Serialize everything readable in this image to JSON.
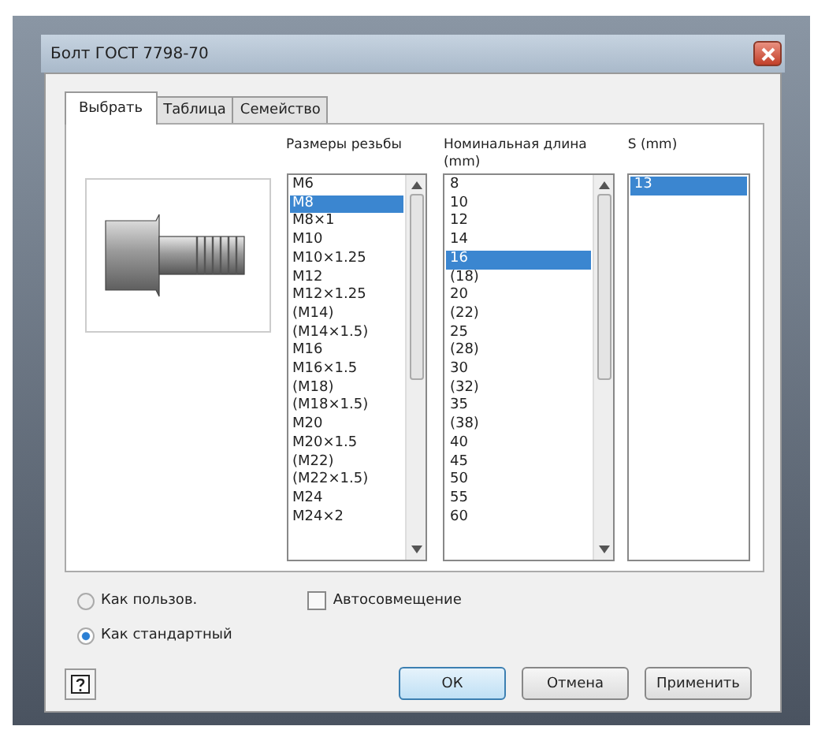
{
  "window": {
    "title": "Болт ГОСТ 7798-70"
  },
  "tabs": [
    {
      "label": "Выбрать",
      "selected": true
    },
    {
      "label": "Таблица",
      "selected": false
    },
    {
      "label": "Семейство",
      "selected": false
    }
  ],
  "lists": [
    {
      "header": "Размеры резьбы",
      "items": [
        {
          "label": "M6",
          "selected": false
        },
        {
          "label": "M8",
          "selected": true
        },
        {
          "label": "M8×1",
          "selected": false
        },
        {
          "label": "M10",
          "selected": false
        },
        {
          "label": "M10×1.25",
          "selected": false
        },
        {
          "label": "M12",
          "selected": false
        },
        {
          "label": "M12×1.25",
          "selected": false
        },
        {
          "label": "(M14)",
          "selected": false
        },
        {
          "label": "(M14×1.5)",
          "selected": false
        },
        {
          "label": "M16",
          "selected": false
        },
        {
          "label": "M16×1.5",
          "selected": false
        },
        {
          "label": "(M18)",
          "selected": false
        },
        {
          "label": "(M18×1.5)",
          "selected": false
        },
        {
          "label": "M20",
          "selected": false
        },
        {
          "label": "M20×1.5",
          "selected": false
        },
        {
          "label": "(M22)",
          "selected": false
        },
        {
          "label": "(M22×1.5)",
          "selected": false
        },
        {
          "label": "M24",
          "selected": false
        },
        {
          "label": "M24×2",
          "selected": false
        }
      ]
    },
    {
      "header": "Номинальная длина (mm)",
      "items": [
        {
          "label": "8",
          "selected": false
        },
        {
          "label": "10",
          "selected": false
        },
        {
          "label": "12",
          "selected": false
        },
        {
          "label": "14",
          "selected": false
        },
        {
          "label": "16",
          "selected": true
        },
        {
          "label": "(18)",
          "selected": false
        },
        {
          "label": "20",
          "selected": false
        },
        {
          "label": "(22)",
          "selected": false
        },
        {
          "label": "25",
          "selected": false
        },
        {
          "label": "(28)",
          "selected": false
        },
        {
          "label": "30",
          "selected": false
        },
        {
          "label": "(32)",
          "selected": false
        },
        {
          "label": "35",
          "selected": false
        },
        {
          "label": "(38)",
          "selected": false
        },
        {
          "label": "40",
          "selected": false
        },
        {
          "label": "45",
          "selected": false
        },
        {
          "label": "50",
          "selected": false
        },
        {
          "label": "55",
          "selected": false
        },
        {
          "label": "60",
          "selected": false
        }
      ]
    },
    {
      "header": "S (mm)",
      "items": [
        {
          "label": "13",
          "selected": true
        }
      ]
    }
  ],
  "options": [
    {
      "label": "Как пользов.",
      "selected": false
    },
    {
      "label": "Как стандартный",
      "selected": true
    }
  ],
  "autofit": {
    "label": "Автосовмещение",
    "checked": false
  },
  "buttons": [
    {
      "label": "ОК",
      "kind": "default"
    },
    {
      "label": "Отмена",
      "kind": "normal"
    },
    {
      "label": "Применить",
      "kind": "normal"
    }
  ]
}
